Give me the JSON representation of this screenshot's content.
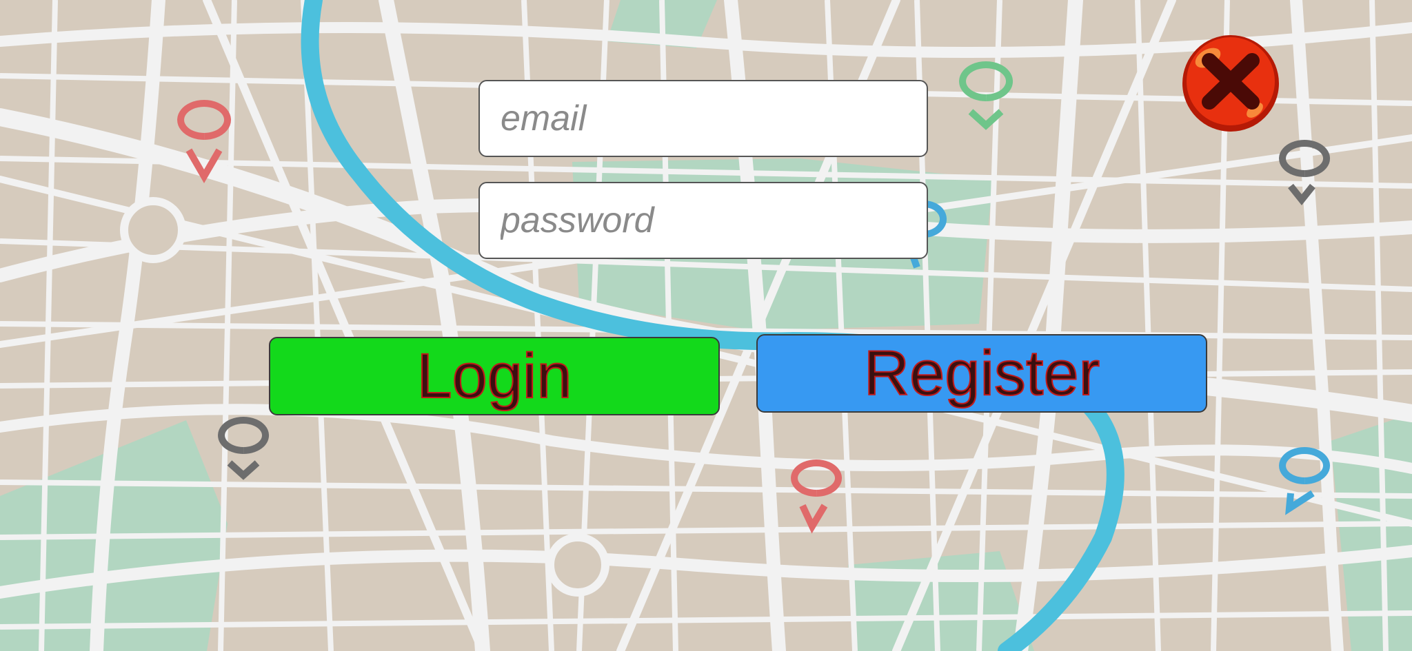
{
  "login_form": {
    "email_placeholder": "email",
    "password_placeholder": "password",
    "login_label": "Login",
    "register_label": "Register"
  },
  "colors": {
    "login_button": "#13d91b",
    "register_button": "#3799f2",
    "close_button": "#e8300f",
    "button_text_outline": "#c21a1a",
    "river": "#4cc0dd",
    "park": "#b2d6c1",
    "map_block": "#d6cbbd",
    "road": "#f2f2f2"
  },
  "icons": {
    "close": "close-x-icon",
    "markers": "map-pin-icon"
  }
}
